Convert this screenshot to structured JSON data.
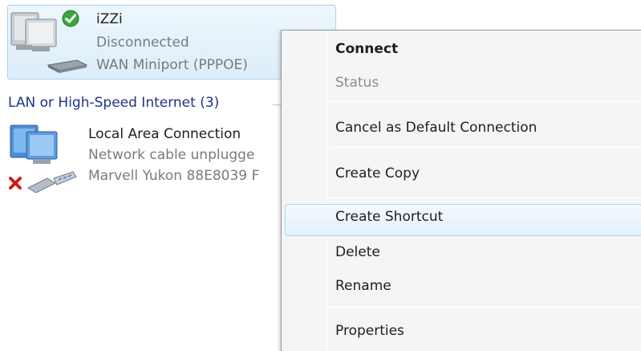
{
  "connections": {
    "izzi": {
      "name": "iZZi",
      "status": "Disconnected",
      "device": "WAN Miniport (PPPOE)"
    },
    "group_header": "LAN or High-Speed Internet (3)",
    "lan": {
      "name": "Local Area Connection",
      "status": "Network cable unplugge",
      "device": "Marvell Yukon 88E8039 F"
    }
  },
  "context_menu": {
    "connect": "Connect",
    "status": "Status",
    "cancel_default": "Cancel as Default Connection",
    "create_copy": "Create Copy",
    "create_shortcut": "Create Shortcut",
    "delete": "Delete",
    "rename": "Rename",
    "properties": "Properties"
  },
  "colors": {
    "selection_border": "#a6d1f0",
    "group_header": "#1e3287",
    "menu_background": "#f5f5f5"
  },
  "icons": {
    "connected_check": "check-circle-icon",
    "disconnected": "red-x-icon"
  }
}
